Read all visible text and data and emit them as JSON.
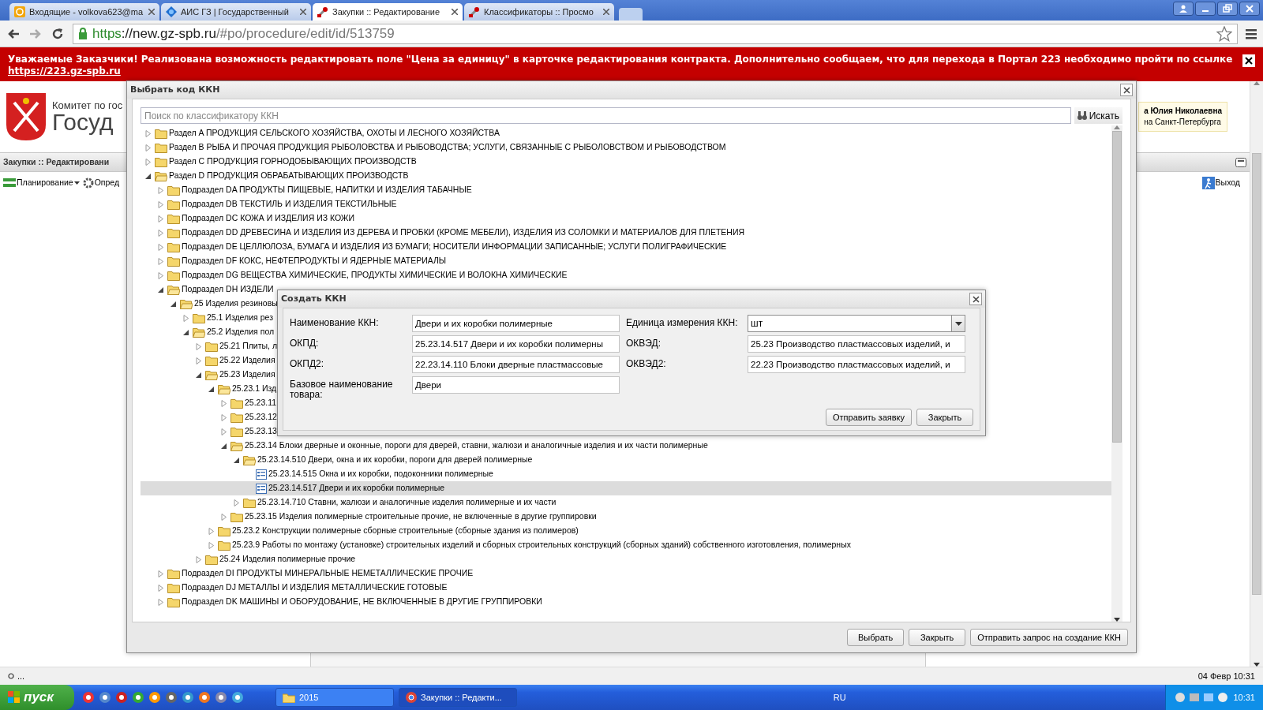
{
  "browser": {
    "tabs": [
      {
        "title": "Входящие - volkova623@ma",
        "kind": "mail",
        "selected": false
      },
      {
        "title": "АИС ГЗ | Государственный",
        "kind": "globe",
        "selected": false
      },
      {
        "title": "Закупки :: Редактирование",
        "kind": "tool",
        "selected": true
      },
      {
        "title": "Классификаторы :: Просмо",
        "kind": "tool",
        "selected": false
      }
    ],
    "address": {
      "scheme": "https",
      "host": "://new.gz-spb.ru",
      "path": "/#po/procedure/edit/id/513759"
    }
  },
  "banner": {
    "message": "Уважаемые Заказчики! Реализована возможность редактировать поле \"Цена за единицу\" в карточке редактирования контракта. Дополнительно сообщаем, что для перехода в Портал 223 необходимо пройти по ссылке",
    "link": "https://223.gz-spb.ru"
  },
  "page": {
    "header_line_1": "Комитет по гос",
    "header_line_2": "Госуд",
    "user_name": "а Юлия Николаевна",
    "user_org": "на Санкт-Петербурга",
    "panel_title": "Закупки :: Редактировани",
    "toolbar": [
      {
        "label": "Планирование",
        "kind": "menu"
      },
      {
        "label": "Опред",
        "kind": "gear"
      }
    ],
    "exit": "Выход"
  },
  "select_dialog": {
    "title": "Выбрать код ККН",
    "search_placeholder": "Поиск по классификатору ККН",
    "search_button": "Искать",
    "tree": [
      {
        "label": "Раздел A ПРОДУКЦИЯ СЕЛЬСКОГО ХОЗЯЙСТВА, ОХОТЫ И ЛЕСНОГО ХОЗЯЙСТВА",
        "kind": "folder",
        "expanded": false,
        "selected": false
      },
      {
        "label": "Раздел B РЫБА И ПРОЧАЯ ПРОДУКЦИЯ РЫБОЛОВСТВА И РЫБОВОДСТВА; УСЛУГИ, СВЯЗАННЫЕ С РЫБОЛОВСТВОМ И РЫБОВОДСТВОМ",
        "kind": "folder",
        "expanded": false,
        "selected": false
      },
      {
        "label": "Раздел C ПРОДУКЦИЯ ГОРНОДОБЫВАЮЩИХ ПРОИЗВОДСТВ",
        "kind": "folder",
        "expanded": false,
        "selected": false
      },
      {
        "label": "Раздел D ПРОДУКЦИЯ ОБРАБАТЫВАЮЩИХ ПРОИЗВОДСТВ",
        "kind": "folder",
        "expanded": true,
        "selected": false,
        "children": [
          {
            "label": "Подраздел DA ПРОДУКТЫ ПИЩЕВЫЕ, НАПИТКИ И ИЗДЕЛИЯ ТАБАЧНЫЕ",
            "kind": "folder",
            "expanded": false,
            "selected": false
          },
          {
            "label": "Подраздел DB ТЕКСТИЛЬ И ИЗДЕЛИЯ ТЕКСТИЛЬНЫЕ",
            "kind": "folder",
            "expanded": false,
            "selected": false
          },
          {
            "label": "Подраздел DC КОЖА И ИЗДЕЛИЯ ИЗ КОЖИ",
            "kind": "folder",
            "expanded": false,
            "selected": false
          },
          {
            "label": "Подраздел DD ДРЕВЕСИНА И ИЗДЕЛИЯ ИЗ ДЕРЕВА И ПРОБКИ (КРОМЕ МЕБЕЛИ), ИЗДЕЛИЯ ИЗ СОЛОМКИ И МАТЕРИАЛОВ ДЛЯ ПЛЕТЕНИЯ",
            "kind": "folder",
            "expanded": false,
            "selected": false
          },
          {
            "label": "Подраздел DE ЦЕЛЛЮЛОЗА, БУМАГА И ИЗДЕЛИЯ ИЗ БУМАГИ; НОСИТЕЛИ ИНФОРМАЦИИ ЗАПИСАННЫЕ; УСЛУГИ ПОЛИГРАФИЧЕСКИЕ",
            "kind": "folder",
            "expanded": false,
            "selected": false
          },
          {
            "label": "Подраздел DF КОКС, НЕФТЕПРОДУКТЫ И ЯДЕРНЫЕ МАТЕРИАЛЫ",
            "kind": "folder",
            "expanded": false,
            "selected": false
          },
          {
            "label": "Подраздел DG ВЕЩЕСТВА ХИМИЧЕСКИЕ, ПРОДУКТЫ ХИМИЧЕСКИЕ И ВОЛОКНА ХИМИЧЕСКИЕ",
            "kind": "folder",
            "expanded": false,
            "selected": false
          },
          {
            "label": "Подраздел DH ИЗДЕЛИ",
            "kind": "folder",
            "expanded": true,
            "selected": false,
            "children": [
              {
                "label": "25 Изделия резиновы",
                "kind": "folder",
                "expanded": true,
                "selected": false,
                "children": [
                  {
                    "label": "25.1 Изделия рез",
                    "kind": "folder",
                    "expanded": false,
                    "selected": false
                  },
                  {
                    "label": "25.2 Изделия пол",
                    "kind": "folder",
                    "expanded": true,
                    "selected": false,
                    "children": [
                      {
                        "label": "25.21 Плиты, л",
                        "kind": "folder",
                        "expanded": false,
                        "selected": false
                      },
                      {
                        "label": "25.22 Изделия",
                        "kind": "folder",
                        "expanded": false,
                        "selected": false
                      },
                      {
                        "label": "25.23 Изделия",
                        "kind": "folder",
                        "expanded": true,
                        "selected": false,
                        "children": [
                          {
                            "label": "25.23.1 Изд",
                            "kind": "folder",
                            "expanded": true,
                            "selected": false,
                            "children": [
                              {
                                "label": "25.23.11",
                                "kind": "folder",
                                "expanded": false,
                                "selected": false
                              },
                              {
                                "label": "25.23.12",
                                "kind": "folder",
                                "expanded": false,
                                "selected": false
                              },
                              {
                                "label": "25.23.13",
                                "kind": "folder",
                                "expanded": false,
                                "selected": false
                              },
                              {
                                "label": "25.23.14 Блоки дверные и оконные, пороги для дверей, ставни, жалюзи и аналогичные изделия и их части полимерные",
                                "kind": "folder",
                                "expanded": true,
                                "selected": false,
                                "children": [
                                  {
                                    "label": "25.23.14.510 Двери, окна и их коробки, пороги для дверей полимерные",
                                    "kind": "folder",
                                    "expanded": true,
                                    "selected": false,
                                    "children": [
                                      {
                                        "label": "25.23.14.515 Окна и их коробки, подоконники полимерные",
                                        "kind": "leaf",
                                        "selected": false
                                      },
                                      {
                                        "label": "25.23.14.517 Двери и их коробки полимерные",
                                        "kind": "leaf",
                                        "selected": true
                                      }
                                    ]
                                  },
                                  {
                                    "label": "25.23.14.710 Ставни, жалюзи и аналогичные изделия полимерные и их части",
                                    "kind": "folder",
                                    "expanded": false,
                                    "selected": false
                                  }
                                ]
                              },
                              {
                                "label": "25.23.15 Изделия полимерные строительные прочие, не включенные в другие группировки",
                                "kind": "folder",
                                "expanded": false,
                                "selected": false
                              }
                            ]
                          },
                          {
                            "label": "25.23.2 Конструкции полимерные сборные строительные (сборные здания из полимеров)",
                            "kind": "folder",
                            "expanded": false,
                            "selected": false
                          },
                          {
                            "label": "25.23.9 Работы по монтажу (установке) строительных изделий и сборных строительных конструкций (сборных зданий) собственного изготовления, полимерных",
                            "kind": "folder",
                            "expanded": false,
                            "selected": false
                          }
                        ]
                      },
                      {
                        "label": "25.24 Изделия полимерные прочие",
                        "kind": "folder",
                        "expanded": false,
                        "selected": false
                      }
                    ]
                  }
                ]
              }
            ]
          },
          {
            "label": "Подраздел DI ПРОДУКТЫ МИНЕРАЛЬНЫЕ НЕМЕТАЛЛИЧЕСКИЕ ПРОЧИЕ",
            "kind": "folder",
            "expanded": false,
            "selected": false
          },
          {
            "label": "Подраздел DJ МЕТАЛЛЫ И ИЗДЕЛИЯ МЕТАЛЛИЧЕСКИЕ ГОТОВЫЕ",
            "kind": "folder",
            "expanded": false,
            "selected": false
          },
          {
            "label": "Подраздел DK МАШИНЫ И ОБОРУДОВАНИЕ, НЕ ВКЛЮЧЕННЫЕ В ДРУГИЕ ГРУППИРОВКИ",
            "kind": "folder",
            "expanded": false,
            "selected": false
          }
        ]
      }
    ],
    "buttons": [
      "Выбрать",
      "Закрыть",
      "Отправить запрос на создание ККН"
    ]
  },
  "create_dialog": {
    "title": "Создать ККН",
    "fields_left": [
      {
        "label": "Наименование ККН:",
        "value": "Двери и их коробки полимерные"
      },
      {
        "label": "ОКПД:",
        "value": "25.23.14.517 Двери и их коробки полимерны"
      },
      {
        "label": "ОКПД2:",
        "value": "22.23.14.110 Блоки дверные пластмассовые"
      },
      {
        "label": "Базовое наименование товара:",
        "value": "Двери"
      }
    ],
    "fields_right": [
      {
        "label": "Единица измерения ККН:",
        "value": "шт",
        "kind": "combo"
      },
      {
        "label": "ОКВЭД:",
        "value": "25.23 Производство пластмассовых изделий, и",
        "kind": "text"
      },
      {
        "label": "ОКВЭД2:",
        "value": "22.23 Производство пластмассовых изделий, и",
        "kind": "text"
      }
    ],
    "buttons": [
      "Отправить заявку",
      "Закрыть"
    ]
  },
  "status_bar": {
    "left": "...",
    "right": "04 Февр 10:31"
  },
  "taskbar": {
    "start": "пуск",
    "windows": [
      {
        "label": "2015",
        "kind": "folder",
        "selected": false
      },
      {
        "label": "Закупки :: Редакти...",
        "kind": "browser",
        "selected": true
      }
    ],
    "language": "RU",
    "clock": "10:31"
  }
}
